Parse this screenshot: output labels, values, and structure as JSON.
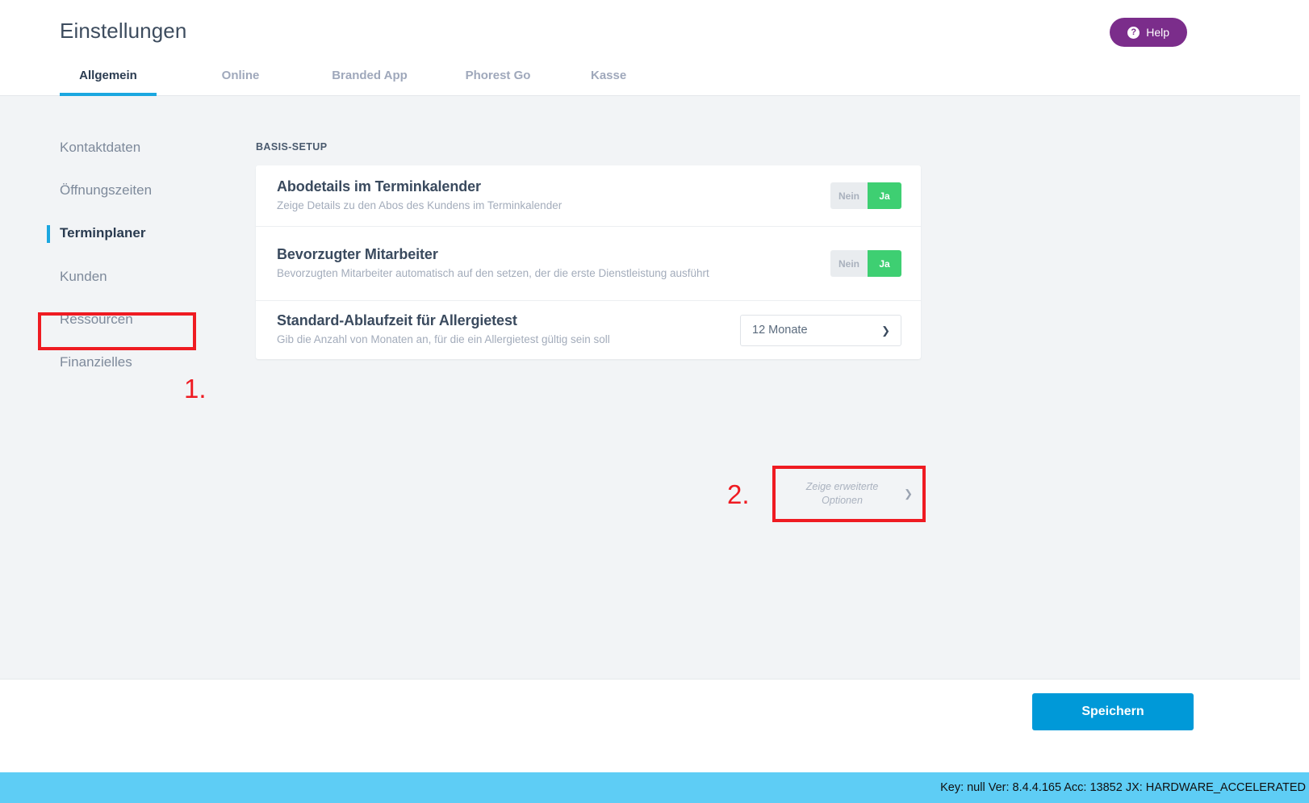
{
  "header": {
    "title": "Einstellungen",
    "help_label": "Help",
    "help_icon": "question-circle-icon",
    "accent_color": "#1ba7e0",
    "help_color": "#7b2d8b"
  },
  "tabs": [
    {
      "label": "Allgemein",
      "active": true
    },
    {
      "label": "Online",
      "active": false
    },
    {
      "label": "Branded App",
      "active": false
    },
    {
      "label": "Phorest Go",
      "active": false
    },
    {
      "label": "Kasse",
      "active": false
    }
  ],
  "sidebar": {
    "items": [
      {
        "label": "Kontaktdaten",
        "active": false
      },
      {
        "label": "Öffnungszeiten",
        "active": false
      },
      {
        "label": "Terminplaner",
        "active": true
      },
      {
        "label": "Kunden",
        "active": false
      },
      {
        "label": "Ressourcen",
        "active": false
      },
      {
        "label": "Finanzielles",
        "active": false
      }
    ]
  },
  "main": {
    "section_label": "BASIS-SETUP",
    "rows": [
      {
        "title": "Abodetails im Terminkalender",
        "desc": "Zeige Details zu den Abos des Kundens im Terminkalender",
        "control": "toggle",
        "off_label": "Nein",
        "on_label": "Ja",
        "value": "Ja"
      },
      {
        "title": "Bevorzugter Mitarbeiter",
        "desc": "Bevorzugten Mitarbeiter automatisch auf den setzen, der die erste Dienstleistung ausführt",
        "control": "toggle",
        "off_label": "Nein",
        "on_label": "Ja",
        "value": "Ja"
      },
      {
        "title": "Standard-Ablaufzeit für Allergietest",
        "desc": "Gib die Anzahl von Monaten an, für die ein Allergietest gültig sein soll",
        "control": "select",
        "value": "12 Monate",
        "chevron": "chevron-down-icon"
      }
    ],
    "advanced_button": {
      "label": "Zeige erweiterte Optionen",
      "chevron": "chevron-right-icon"
    }
  },
  "annotations": {
    "color": "#ef1b22",
    "step_1": "1.",
    "step_2": "2."
  },
  "footer": {
    "save_label": "Speichern",
    "save_color": "#0099d8"
  },
  "statusbar": {
    "text": "Key: null Ver: 8.4.4.165 Acc: 13852  JX: HARDWARE_ACCELERATED",
    "background": "#5ecdf5"
  }
}
